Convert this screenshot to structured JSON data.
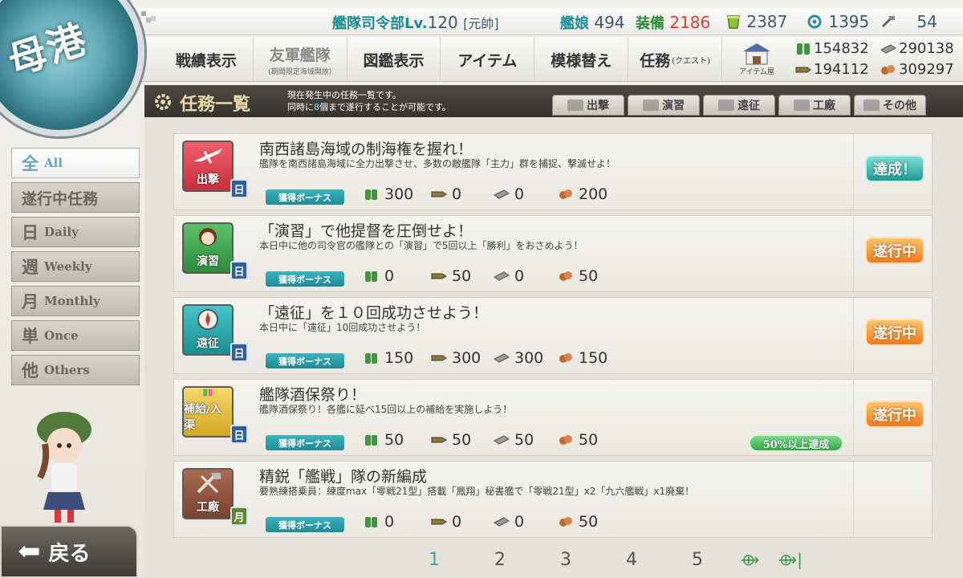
{
  "port": {
    "label": "母港"
  },
  "status": {
    "hq_label": "艦隊司令部Lv.",
    "hq_level": "120",
    "rank": "[元帥]",
    "ships_label": "艦娘",
    "ships": "494",
    "equip_label": "装備",
    "equip": "2186",
    "bucket": "2387",
    "devmat": "1395",
    "screws": "54"
  },
  "nav": {
    "items": [
      {
        "label": "戦績表示",
        "sub": ""
      },
      {
        "label": "友軍艦隊",
        "sub": "(期間限定海域開放)"
      },
      {
        "label": "図鑑表示",
        "sub": ""
      },
      {
        "label": "アイテム",
        "sub": ""
      },
      {
        "label": "模様替え",
        "sub": ""
      },
      {
        "label": "任務",
        "sub": "(クエスト)"
      }
    ],
    "item_shop": "アイテム屋"
  },
  "resources": {
    "fuel": "154832",
    "steel": "290138",
    "ammo": "194112",
    "bauxite": "309297"
  },
  "header": {
    "title": "任務一覧",
    "desc_line1": "現在発生中の任務一覧です。",
    "desc_line2_prefix": "同時に",
    "desc_line2_count": "8",
    "desc_line2_suffix": "個まで遂行することが可能です。"
  },
  "category_tabs": [
    "出撃",
    "演習",
    "遠征",
    "工廠",
    "その他"
  ],
  "left_tabs": [
    {
      "k": "全",
      "e": "All"
    },
    {
      "full": "遂行中任務"
    },
    {
      "k": "日",
      "e": "Daily"
    },
    {
      "k": "週",
      "e": "Weekly"
    },
    {
      "k": "月",
      "e": "Monthly"
    },
    {
      "k": "単",
      "e": "Once"
    },
    {
      "k": "他",
      "e": "Others"
    }
  ],
  "bonus_label": "獲得ボーナス",
  "quests": [
    {
      "icon_label": "出撃",
      "freq": "日",
      "title": "南西諸島海域の制海権を握れ！",
      "desc": "艦隊を南西諸島海域に全力出撃させ、多数の敵艦隊「主力」群を捕捉、撃滅せよ！",
      "fuel": "300",
      "ammo": "0",
      "steel": "0",
      "bauxite": "200",
      "status": "達成！"
    },
    {
      "icon_label": "演習",
      "freq": "日",
      "title": "「演習」で他提督を圧倒せよ！",
      "desc": "本日中に他の司令官の艦隊との「演習」で5回以上「勝利」をおさめよう！",
      "fuel": "0",
      "ammo": "50",
      "steel": "0",
      "bauxite": "50",
      "status": "遂行中"
    },
    {
      "icon_label": "遠征",
      "freq": "日",
      "title": "「遠征」を１０回成功させよう！",
      "desc": "本日中に「遠征」10回成功させよう！",
      "fuel": "150",
      "ammo": "300",
      "steel": "300",
      "bauxite": "150",
      "status": "遂行中"
    },
    {
      "icon_label": "補給/入渠",
      "freq": "日",
      "title": "艦隊酒保祭り！",
      "desc": "艦隊酒保祭り！各艦に延べ15回以上の補給を実施しよう！",
      "fuel": "50",
      "ammo": "50",
      "steel": "50",
      "bauxite": "50",
      "status": "遂行中",
      "progress": "50%以上達成"
    },
    {
      "icon_label": "工廠",
      "freq": "月",
      "title": "精鋭「艦戦」隊の新編成",
      "desc": "要熟練搭乗員：練度max「零戦21型」搭載「鳳翔」秘書艦で「零戦21型」x2「九六艦戦」x1廃棄！",
      "fuel": "0",
      "ammo": "0",
      "steel": "0",
      "bauxite": "50",
      "status": ""
    }
  ],
  "pagination": {
    "pages": [
      "1",
      "2",
      "3",
      "4",
      "5"
    ],
    "active": "1"
  },
  "back": {
    "label": "戻る"
  },
  "colors": {
    "accent": "#3aa6b5",
    "done": "#1e9a94",
    "progress": "#ee7a1c"
  }
}
